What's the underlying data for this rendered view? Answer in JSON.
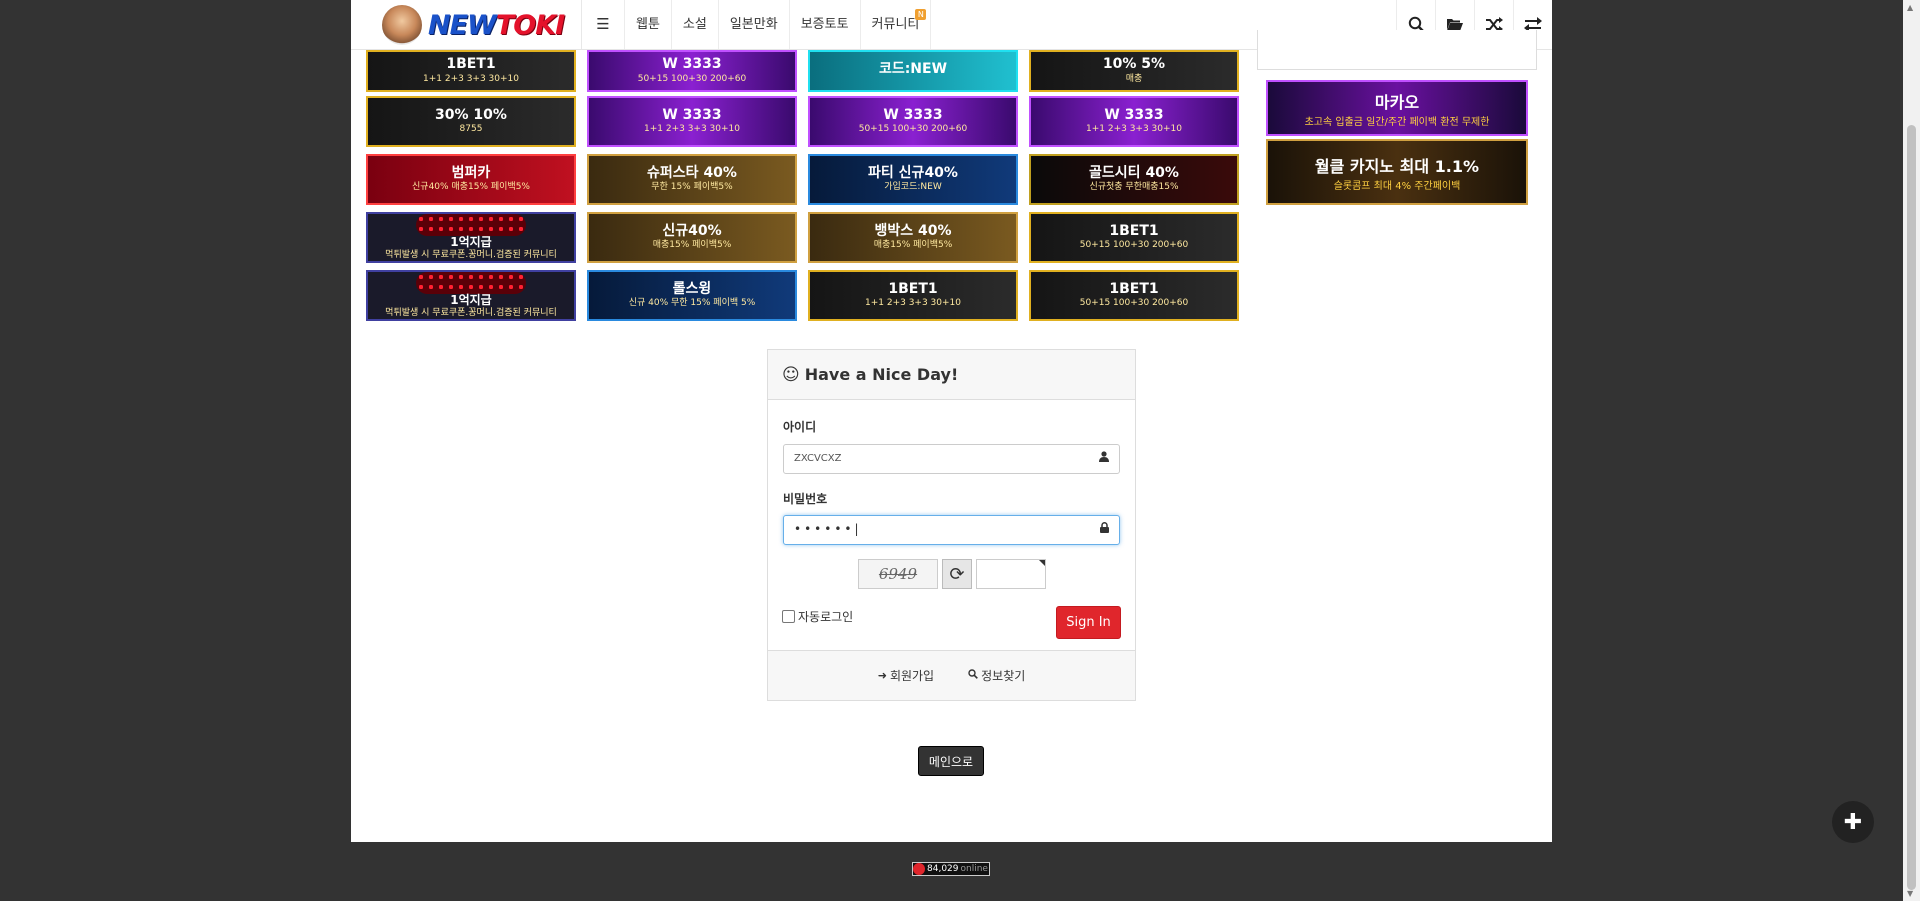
{
  "header": {
    "logo_text_a": "NEW",
    "logo_text_b": "TOKI",
    "nav": [
      {
        "label": "웹툰"
      },
      {
        "label": "소설"
      },
      {
        "label": "일본만화"
      },
      {
        "label": "보증토토"
      },
      {
        "label": "커뮤니티",
        "badge": "N"
      }
    ]
  },
  "banners": [
    {
      "title": "1BET1",
      "sub": "1+1 2+3 3+3 30+10"
    },
    {
      "title": "W 3333",
      "sub": "50+15 100+30 200+60"
    },
    {
      "title": "코드:NEW",
      "sub": ""
    },
    {
      "title": "10% 5%",
      "sub": "매충"
    },
    {
      "title": "30% 10%",
      "sub": "8755"
    },
    {
      "title": "W 3333",
      "sub": "1+1 2+3 3+3 30+10"
    },
    {
      "title": "W 3333",
      "sub": "50+15 100+30 200+60"
    },
    {
      "title": "W 3333",
      "sub": "1+1 2+3 3+3 30+10"
    },
    {
      "title": "범퍼카",
      "sub": "신규40% 매충15% 페이백5%"
    },
    {
      "title": "슈퍼스타 40%",
      "sub": "무한 15% 페이백5%"
    },
    {
      "title": "파티 신규40%",
      "sub": "가입코드:NEW"
    },
    {
      "title": "골드시티 40%",
      "sub": "신규첫충 무한매충15%"
    },
    {
      "title": "1억지급",
      "sub": "먹튀발생 시 무료쿠폰.꽁머니.검증된 커뮤니티"
    },
    {
      "title": "신규40%",
      "sub": "매충15% 페이백5%"
    },
    {
      "title": "뱅박스 40%",
      "sub": "매충15% 페이백5%"
    },
    {
      "title": "1BET1",
      "sub": "50+15 100+30 200+60"
    },
    {
      "title": "1억지급",
      "sub": "먹튀발생 시 무료쿠폰.꽁머니.검증된 커뮤니티"
    },
    {
      "title": "롤스윙",
      "sub": "신규 40% 무한 15% 페이백 5%"
    },
    {
      "title": "1BET1",
      "sub": "1+1 2+3 3+3 30+10"
    },
    {
      "title": "1BET1",
      "sub": "50+15 100+30 200+60"
    }
  ],
  "side_banners": [
    {
      "title": "마카오",
      "sub": "초고속 입출금 일간/주간 페이백 환전 무제한"
    },
    {
      "title": "월클 카지노 최대 1.1%",
      "sub": "슬롯콤프 최대 4% 주간페이백"
    }
  ],
  "login": {
    "title": "Have a Nice Day!",
    "id_label": "아이디",
    "id_value": "ZXCVCXZ",
    "pw_label": "비밀번호",
    "pw_value": "••••••|",
    "captcha_text": "6949",
    "auto_login_label": "자동로그인",
    "signin_label": "Sign In",
    "register_label": "회원가입",
    "find_label": "정보찾기"
  },
  "main_button_label": "메인으로",
  "counter": {
    "count": "84,029",
    "label": "online"
  }
}
